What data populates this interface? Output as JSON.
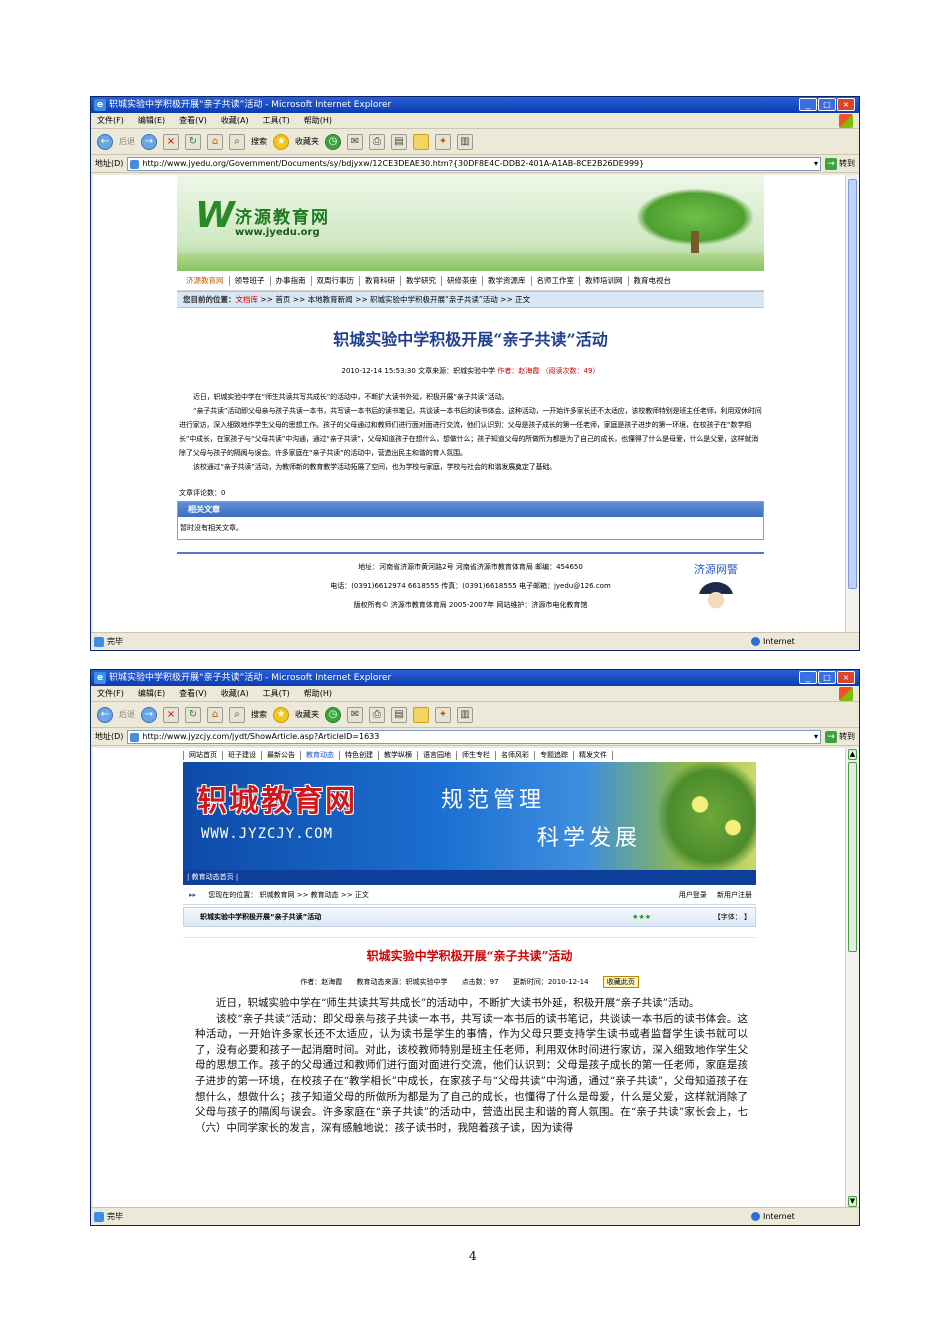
{
  "windows": [
    {
      "title": "轵城实验中学积极开展“亲子共读”活动 - Microsoft Internet Explorer",
      "menu": [
        "文件(F)",
        "编辑(E)",
        "查看(V)",
        "收藏(A)",
        "工具(T)",
        "帮助(H)"
      ],
      "toolbar": {
        "back": "后退",
        "search": "搜索",
        "favorites": "收藏夹"
      },
      "address_label": "地址(D)",
      "url": "http://www.jyedu.org/Government/Documents/sy/bdjyxw/12CE3DEAE30.htm?{30DF8E4C-DDB2-401A-A1AB-8CE2B26DE999}",
      "go_label": "转到",
      "status": "完毕",
      "zone": "Internet"
    },
    {
      "title": "轵城实验中学积极开展“亲子共读”活动 - Microsoft Internet Explorer",
      "menu": [
        "文件(F)",
        "编辑(E)",
        "查看(V)",
        "收藏(A)",
        "工具(T)",
        "帮助(H)"
      ],
      "toolbar": {
        "back": "后退",
        "search": "搜索",
        "favorites": "收藏夹"
      },
      "address_label": "地址(D)",
      "url": "http://www.jyzcjy.com/jydt/ShowArticle.asp?ArticleID=1633",
      "go_label": "转到",
      "status": "完毕",
      "zone": "Internet"
    }
  ],
  "page1": {
    "logo_cn": "济源教育网",
    "logo_url": "www.jyedu.org",
    "nav": [
      "济源教育网",
      "领导班子",
      "办事指南",
      "双周行事历",
      "教育科研",
      "教学研究",
      "研修茶座",
      "教学资源库",
      "名师工作室",
      "教师培训网",
      "教育电视台"
    ],
    "crumb": {
      "label": "您目前的位置：",
      "root": "文档库",
      "path": ">> 首页 >> 本地教育新闻 >> 轵城实验中学积极开展“亲子共读”活动 >> 正文"
    },
    "title": "轵城实验中学积极开展“亲子共读”活动",
    "meta": {
      "date": "2010-12-14 15:53:30",
      "source": "文章来源：轵城实验中学",
      "author": "作者：赵海霞",
      "views": "（阅读次数：49）"
    },
    "paragraphs": [
      "近日，轵城实验中学在“师生共读共写共成长”的活动中，不断扩大读书外延，积极开展“亲子共读”活动。",
      "“亲子共读”活动即父母亲与孩子共读一本书，共写读一本书后的读书笔记，共谈读一本书后的读书体会。这种活动，一开始许多家长还不太适应，该校教师特别是班主任老师，利用双休时间进行家访，深入细致地作学生父母的思想工作。孩子的父母通过和教师们进行面对面进行交流，他们认识到：父母是孩子成长的第一任老师，家庭是孩子进步的第一环境，在校孩子在“数学相长”中成长，在家孩子与“父母共读”中沟通，通过“亲子共读”，父母知道孩子在想什么，想做什么；孩子知道父母的所做所为都是为了自己的成长，也懂得了什么是母爱，什么是父爱，这样就消除了父母与孩子的隔阂与误会。许多家庭在“亲子共读”的活动中，营造出民主和谐的育人氛围。",
      "该校通过“亲子共读”活动，为教师新的教育教学活动拓展了空间，也为学校与家庭，学校与社会的和谐发展奠定了基础。"
    ],
    "comments": "文章评论数：0",
    "related": {
      "header": "相关文章",
      "empty": "暂时没有相关文章。"
    },
    "footer": {
      "address": "地址：河南省济源市黄河路2号  河南省济源市教育体育局  邮编：454650",
      "phone": "电话：(0391)6612974 6618555  传真：(0391)6618555  电子邮箱：jyedu@126.com",
      "copyright": "版权所有© 济源市教育体育局  2005-2007年  网站维护：济源市电化教育馆",
      "police": "济源网警"
    }
  },
  "page2": {
    "nav": [
      "网站首页",
      "班子建设",
      "最新公告",
      "教育动态",
      "特色创建",
      "教学纵横",
      "语言园地",
      "师生专栏",
      "名师风彩",
      "专题追踪",
      "精发文件"
    ],
    "logo_cn": "轵城教育网",
    "logo_url": "WWW.JYZCJY.COM",
    "slogan1": "规范管理",
    "slogan2": "科学发展",
    "subnav": "教育动态首页",
    "location": "您现在的位置：  轵城教育网 >> 教育动态 >> 正文",
    "login": "用户登录",
    "register": "新用户注册",
    "article_head": "轵城实验中学积极开展“亲子共读”活动",
    "stars": "★★★",
    "font_label": "【字体：    】",
    "title": "轵城实验中学积极开展“亲子共读”活动",
    "meta": {
      "author": "作者：赵海霞",
      "source": "教育动态来源：轵城实验中学",
      "hits": "点击数：97",
      "updated": "更新时间：2010-12-14",
      "fav": "收藏此页"
    },
    "paragraphs": [
      "近日，轵城实验中学在“师生共读共写共成长”的活动中，不断扩大读书外延，积极开展“亲子共读”活动。",
      "该校“亲子共读”活动：即父母亲与孩子共读一本书，共写读一本书后的读书笔记，共谈读一本书后的读书体会。这种活动，一开始许多家长还不太适应，认为读书是学生的事情，作为父母只要支持学生读书或者监督学生读书就可以了，没有必要和孩子一起消磨时间。对此，该校教师特别是班主任老师，利用双休时间进行家访，深入细致地作学生父母的思想工作。孩子的父母通过和教师们进行面对面进行交流，他们认识到：父母是孩子成长的第一任老师，家庭是孩子进步的第一环境，在校孩子在“教学相长”中成长，在家孩子与“父母共读”中沟通，通过“亲子共读”，父母知道孩子在想什么，想做什么；孩子知道父母的所做所为都是为了自己的成长，也懂得了什么是母爱，什么是父爱，这样就消除了父母与孩子的隔阂与误会。许多家庭在“亲子共读”的活动中，营造出民主和谐的育人氛围。在“亲子共读”家长会上，七（六）中同学家长的发言，深有感触地说：孩子读书时，我陪着孩子读，因为读得"
    ]
  },
  "page_number": "4"
}
